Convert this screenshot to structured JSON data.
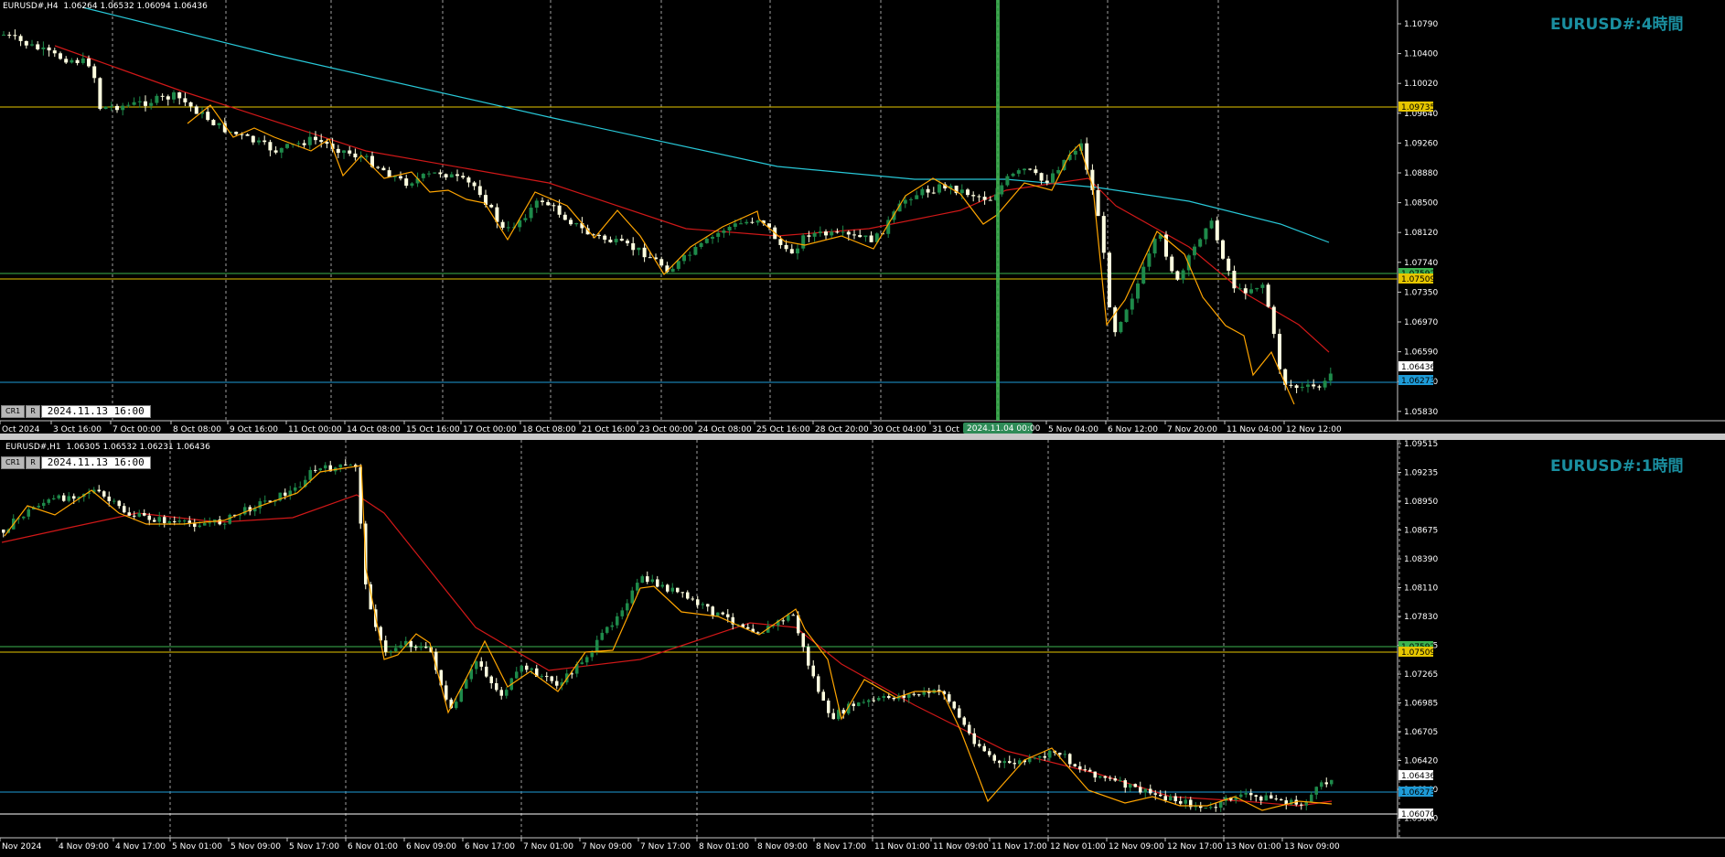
{
  "colors": {
    "background": "#000000",
    "bull": "#1e8a4a",
    "bear": "#ffffe0",
    "ma_red": "#d01818",
    "ma_cyan": "#28c8d8",
    "zigzag": "#ffa500",
    "line_yellow": "#e6c600",
    "line_green": "#3cb450",
    "line_blue": "#1e9bd7",
    "line_white": "#ffffff",
    "grid": "#a0a0a0",
    "watermark": "#1a8fa0"
  },
  "panel_h4": {
    "info": "EURUSD#,H4  1.06264 1.06532 1.06094 1.06436",
    "watermark": "EURUSD#:4時間",
    "buttons": [
      "CR1",
      "R"
    ],
    "datetime": "2024.11.13 16:00",
    "price_labels": [
      "1.10790",
      "1.10400",
      "1.10020",
      "1.09640",
      "1.09260",
      "1.08880",
      "1.08500",
      "1.08120",
      "1.07740",
      "1.07350",
      "1.06970",
      "1.06590",
      "1.06210",
      "1.05830"
    ],
    "price_tags": {
      "yellow": "1.09735",
      "green": "1.07592",
      "yellow2": "1.07509",
      "current": "1.06436",
      "blue": "1.06273"
    },
    "time_labels": [
      "Oct 2024",
      "3 Oct 16:00",
      "7 Oct 00:00",
      "8 Oct 08:00",
      "9 Oct 16:00",
      "11 Oct 00:00",
      "14 Oct 08:00",
      "15 Oct 16:00",
      "17 Oct 00:00",
      "18 Oct 08:00",
      "21 Oct 16:00",
      "23 Oct 00:00",
      "24 Oct 08:00",
      "25 Oct 16:00",
      "28 Oct 20:00",
      "30 Oct 04:00",
      "31 Oct",
      "5 Nov 04:00",
      "6 Nov 12:00",
      "7 Nov 20:00",
      "11 Nov 04:00",
      "12 Nov 12:00"
    ],
    "cursor_time": "2024.11.04 00:00"
  },
  "panel_h1": {
    "info": "EURUSD#,H1  1.06305 1.06532 1.06231 1.06436",
    "watermark": "EURUSD#:1時間",
    "buttons": [
      "CR1",
      "R"
    ],
    "datetime": "2024.11.13 16:00",
    "price_labels": [
      "1.09515",
      "1.09235",
      "1.08950",
      "1.08675",
      "1.08390",
      "1.08110",
      "1.07830",
      "1.07545",
      "1.07265",
      "1.06985",
      "1.06705",
      "1.06420",
      "1.06140",
      "1.05860"
    ],
    "price_tags": {
      "green": "1.07592",
      "yellow": "1.07509",
      "current": "1.06436",
      "blue": "1.06273",
      "white": "1.06070"
    },
    "time_labels": [
      "Nov 2024",
      "4 Nov 09:00",
      "4 Nov 17:00",
      "5 Nov 01:00",
      "5 Nov 09:00",
      "5 Nov 17:00",
      "6 Nov 01:00",
      "6 Nov 09:00",
      "6 Nov 17:00",
      "7 Nov 01:00",
      "7 Nov 09:00",
      "7 Nov 17:00",
      "8 Nov 01:00",
      "8 Nov 09:00",
      "8 Nov 17:00",
      "11 Nov 01:00",
      "11 Nov 09:00",
      "11 Nov 17:00",
      "12 Nov 01:00",
      "12 Nov 09:00",
      "12 Nov 17:00",
      "13 Nov 01:00",
      "13 Nov 09:00"
    ]
  }
}
